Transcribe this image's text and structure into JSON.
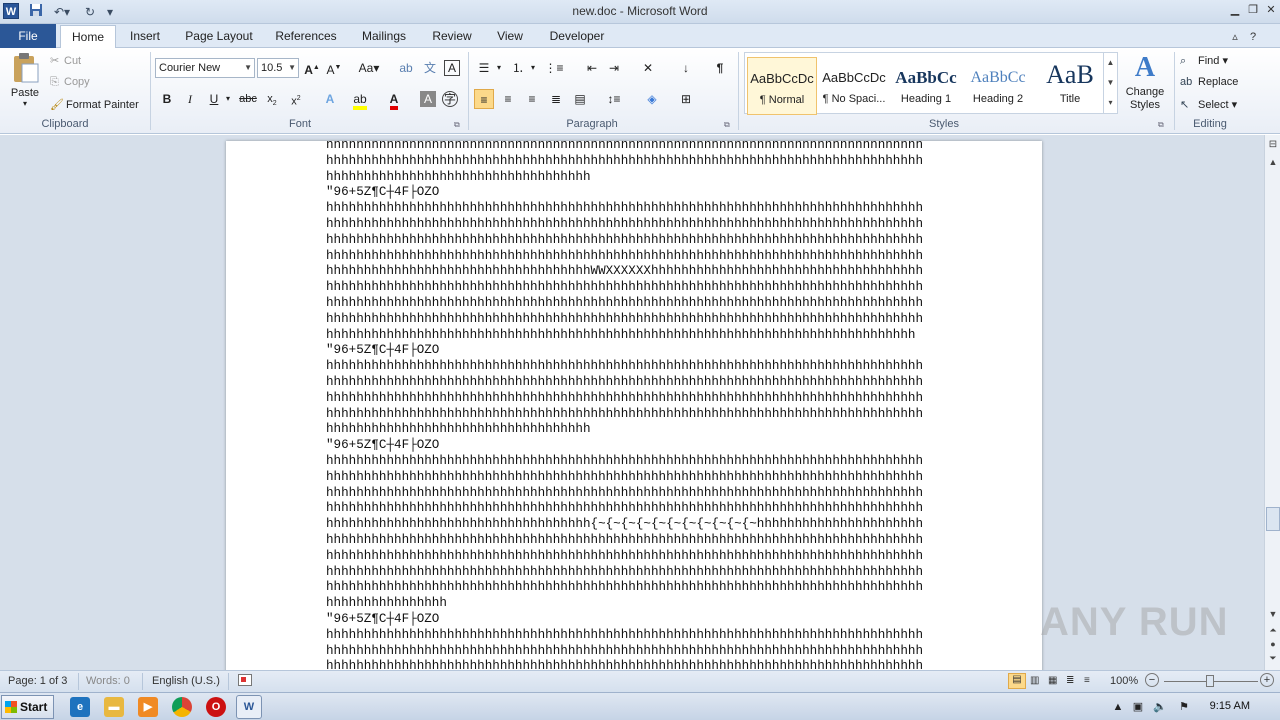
{
  "window": {
    "title": "new.doc - Microsoft Word",
    "app_icon": "W"
  },
  "tabs": [
    "File",
    "Home",
    "Insert",
    "Page Layout",
    "References",
    "Mailings",
    "Review",
    "View",
    "Developer"
  ],
  "ribbon": {
    "clipboard": {
      "paste": "Paste",
      "cut": "Cut",
      "copy": "Copy",
      "format_painter": "Format Painter",
      "label": "Clipboard"
    },
    "font": {
      "family": "Courier New",
      "size": "10.5",
      "label": "Font",
      "change_case": "Aa"
    },
    "paragraph": {
      "label": "Paragraph"
    },
    "styles": {
      "label": "Styles",
      "items": [
        {
          "sample": "AaBbCcDc",
          "name": "¶ Normal"
        },
        {
          "sample": "AaBbCcDc",
          "name": "¶ No Spaci..."
        },
        {
          "sample": "AaBbCc",
          "name": "Heading 1"
        },
        {
          "sample": "AaBbCc",
          "name": "Heading 2"
        },
        {
          "sample": "AaB",
          "name": "Title"
        }
      ],
      "change_styles": "Change Styles"
    },
    "editing": {
      "label": "Editing",
      "find": "Find",
      "replace": "Replace",
      "select": "Select"
    }
  },
  "document": {
    "lines": [
      "hhhhhhhhhhhhhhhhhhhhhhhhhhhhhhhhhhhhhhhhhhhhhhhhhhhhhhhhhhhhhhhhhhhhhhhhhhhhhhh",
      "hhhhhhhhhhhhhhhhhhhhhhhhhhhhhhhhhhhhhhhhhhhhhhhhhhhhhhhhhhhhhhhhhhhhhhhhhhhhhhh",
      "hhhhhhhhhhhhhhhhhhhhhhhhhhhhhhhhhhh",
      "\"96+5Z¶C┼4F├OZO",
      "hhhhhhhhhhhhhhhhhhhhhhhhhhhhhhhhhhhhhhhhhhhhhhhhhhhhhhhhhhhhhhhhhhhhhhhhhhhhhhh",
      "hhhhhhhhhhhhhhhhhhhhhhhhhhhhhhhhhhhhhhhhhhhhhhhhhhhhhhhhhhhhhhhhhhhhhhhhhhhhhhh",
      "hhhhhhhhhhhhhhhhhhhhhhhhhhhhhhhhhhhhhhhhhhhhhhhhhhhhhhhhhhhhhhhhhhhhhhhhhhhhhhh",
      "hhhhhhhhhhhhhhhhhhhhhhhhhhhhhhhhhhhhhhhhhhhhhhhhhhhhhhhhhhhhhhhhhhhhhhhhhhhhhhh",
      "hhhhhhhhhhhhhhhhhhhhhhhhhhhhhhhhhhhWWXXXXXXhhhhhhhhhhhhhhhhhhhhhhhhhhhhhhhhhhhh",
      "hhhhhhhhhhhhhhhhhhhhhhhhhhhhhhhhhhhhhhhhhhhhhhhhhhhhhhhhhhhhhhhhhhhhhhhhhhhhhhh",
      "hhhhhhhhhhhhhhhhhhhhhhhhhhhhhhhhhhhhhhhhhhhhhhhhhhhhhhhhhhhhhhhhhhhhhhhhhhhhhhh",
      "hhhhhhhhhhhhhhhhhhhhhhhhhhhhhhhhhhhhhhhhhhhhhhhhhhhhhhhhhhhhhhhhhhhhhhhhhhhhhhh",
      "hhhhhhhhhhhhhhhhhhhhhhhhhhhhhhhhhhhhhhhhhhhhhhhhhhhhhhhhhhhhhhhhhhhhhhhhhhhhhh",
      "\"96+5Z¶C┼4F├OZO",
      "hhhhhhhhhhhhhhhhhhhhhhhhhhhhhhhhhhhhhhhhhhhhhhhhhhhhhhhhhhhhhhhhhhhhhhhhhhhhhhh",
      "hhhhhhhhhhhhhhhhhhhhhhhhhhhhhhhhhhhhhhhhhhhhhhhhhhhhhhhhhhhhhhhhhhhhhhhhhhhhhhh",
      "hhhhhhhhhhhhhhhhhhhhhhhhhhhhhhhhhhhhhhhhhhhhhhhhhhhhhhhhhhhhhhhhhhhhhhhhhhhhhhh",
      "hhhhhhhhhhhhhhhhhhhhhhhhhhhhhhhhhhhhhhhhhhhhhhhhhhhhhhhhhhhhhhhhhhhhhhhhhhhhhhh",
      "hhhhhhhhhhhhhhhhhhhhhhhhhhhhhhhhhhh",
      "\"96+5Z¶C┼4F├OZO",
      "hhhhhhhhhhhhhhhhhhhhhhhhhhhhhhhhhhhhhhhhhhhhhhhhhhhhhhhhhhhhhhhhhhhhhhhhhhhhhhh",
      "hhhhhhhhhhhhhhhhhhhhhhhhhhhhhhhhhhhhhhhhhhhhhhhhhhhhhhhhhhhhhhhhhhhhhhhhhhhhhhh",
      "hhhhhhhhhhhhhhhhhhhhhhhhhhhhhhhhhhhhhhhhhhhhhhhhhhhhhhhhhhhhhhhhhhhhhhhhhhhhhhh",
      "hhhhhhhhhhhhhhhhhhhhhhhhhhhhhhhhhhhhhhhhhhhhhhhhhhhhhhhhhhhhhhhhhhhhhhhhhhhhhhh",
      "hhhhhhhhhhhhhhhhhhhhhhhhhhhhhhhhhhh{~{~{~{~{~{~{~{~{~{~{~hhhhhhhhhhhhhhhhhhhhhh",
      "hhhhhhhhhhhhhhhhhhhhhhhhhhhhhhhhhhhhhhhhhhhhhhhhhhhhhhhhhhhhhhhhhhhhhhhhhhhhhhh",
      "hhhhhhhhhhhhhhhhhhhhhhhhhhhhhhhhhhhhhhhhhhhhhhhhhhhhhhhhhhhhhhhhhhhhhhhhhhhhhhh",
      "hhhhhhhhhhhhhhhhhhhhhhhhhhhhhhhhhhhhhhhhhhhhhhhhhhhhhhhhhhhhhhhhhhhhhhhhhhhhhhh",
      "hhhhhhhhhhhhhhhhhhhhhhhhhhhhhhhhhhhhhhhhhhhhhhhhhhhhhhhhhhhhhhhhhhhhhhhhhhhhhhh",
      "hhhhhhhhhhhhhhhh",
      "\"96+5Z¶C┼4F├OZO",
      "hhhhhhhhhhhhhhhhhhhhhhhhhhhhhhhhhhhhhhhhhhhhhhhhhhhhhhhhhhhhhhhhhhhhhhhhhhhhhhh",
      "hhhhhhhhhhhhhhhhhhhhhhhhhhhhhhhhhhhhhhhhhhhhhhhhhhhhhhhhhhhhhhhhhhhhhhhhhhhhhhh",
      "hhhhhhhhhhhhhhhhhhhhhhhhhhhhhhhhhhhhhhhhhhhhhhhhhhhhhhhhhhhhhhhhhhhhhhhhhhhhhhh"
    ]
  },
  "statusbar": {
    "page": "Page: 1 of 3",
    "words": "Words: 0",
    "language": "English (U.S.)",
    "zoom": "100%"
  },
  "taskbar": {
    "start": "Start",
    "time": "9:15 AM"
  },
  "watermark": "ANY RUN"
}
